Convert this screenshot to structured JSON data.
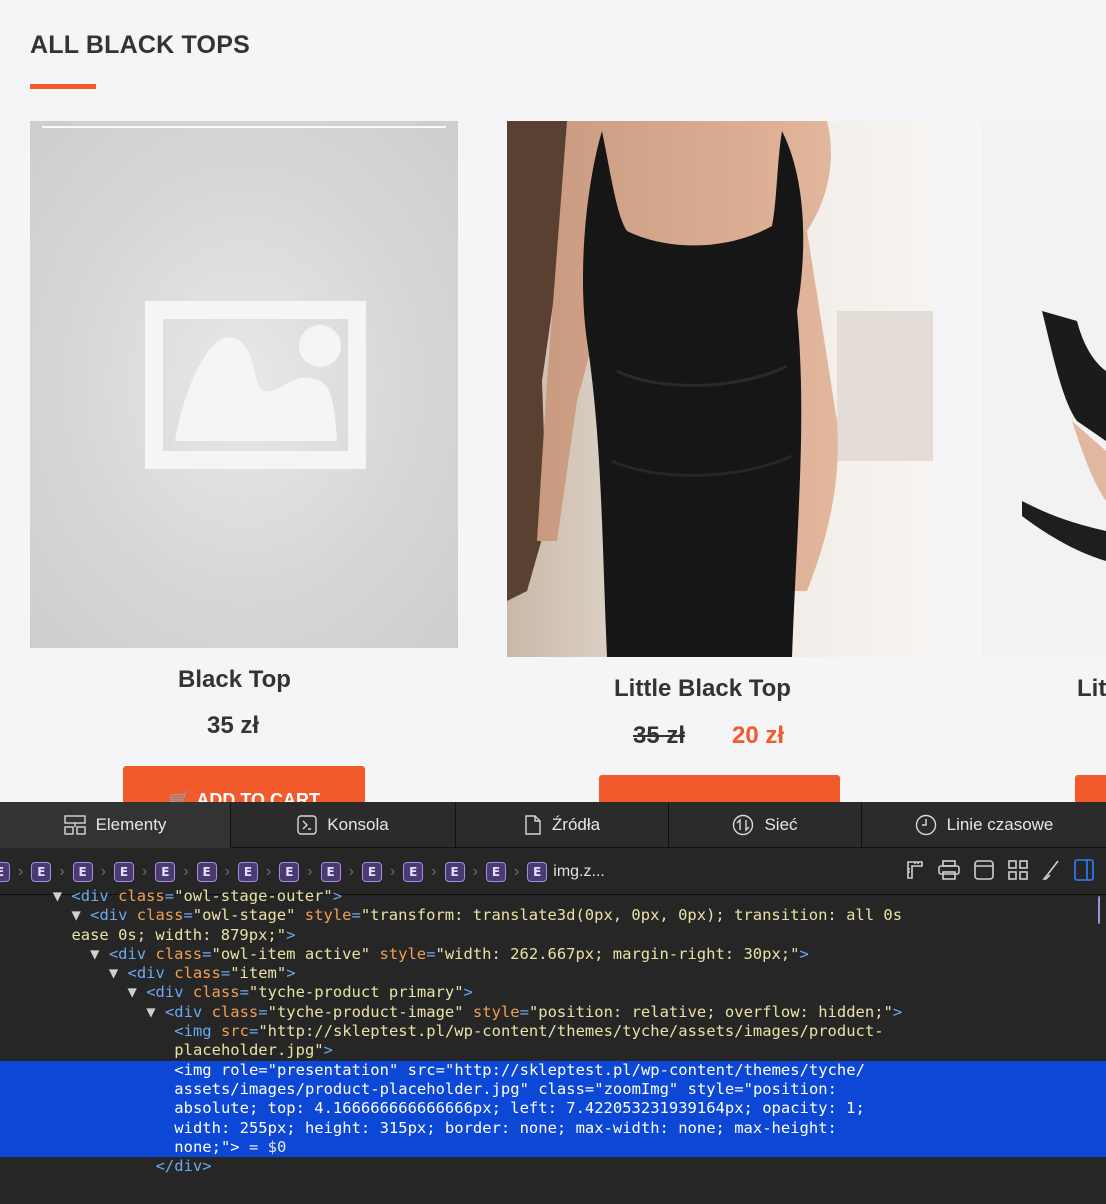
{
  "section": {
    "title": "ALL BLACK TOPS"
  },
  "products": [
    {
      "name": "Black Top",
      "price": "35 zł",
      "button": "ADD TO CART",
      "image": "placeholder-image-icon"
    },
    {
      "name": "Little Black Top",
      "old_price": "35 zł",
      "sale_price": "20 zł",
      "image": "woman-in-black-tank-top-photo"
    },
    {
      "name": "Lit",
      "image": "woman-in-black-long-sleeve-top-photo"
    }
  ],
  "devtools": {
    "tabs": [
      {
        "label": "Elementy",
        "icon": "elements-icon"
      },
      {
        "label": "Konsola",
        "icon": "console-icon"
      },
      {
        "label": "Źródła",
        "icon": "sources-icon"
      },
      {
        "label": "Sieć",
        "icon": "network-icon"
      },
      {
        "label": "Linie czasowe",
        "icon": "timeline-icon"
      }
    ],
    "breadcrumb": {
      "badge": "E",
      "last": "img.z..."
    },
    "dom": [
      {
        "tokens": [
          [
            "tri",
            "▼ "
          ],
          [
            "tag",
            "<div "
          ],
          [
            "attr",
            "class"
          ],
          [
            "tag",
            "="
          ],
          [
            "val",
            "\"owl-stage-outer\""
          ],
          [
            "tag",
            ">"
          ]
        ],
        "indent": 5,
        "clipped": true
      },
      {
        "tokens": [
          [
            "tri",
            "▼ "
          ],
          [
            "tag",
            "<div "
          ],
          [
            "attr",
            "class"
          ],
          [
            "tag",
            "="
          ],
          [
            "val",
            "\"owl-stage\""
          ],
          [
            "txt",
            " "
          ],
          [
            "attr",
            "style"
          ],
          [
            "tag",
            "="
          ],
          [
            "val",
            "\"transform: translate3d(0px, 0px, 0px); transition: all 0s"
          ]
        ],
        "indent": 7
      },
      {
        "tokens": [
          [
            "val",
            "ease 0s; width: 879px;\""
          ],
          [
            "tag",
            ">"
          ]
        ],
        "indent": 7
      },
      {
        "tokens": [
          [
            "tri",
            "▼ "
          ],
          [
            "tag",
            "<div "
          ],
          [
            "attr",
            "class"
          ],
          [
            "tag",
            "="
          ],
          [
            "val",
            "\"owl-item active\""
          ],
          [
            "txt",
            " "
          ],
          [
            "attr",
            "style"
          ],
          [
            "tag",
            "="
          ],
          [
            "val",
            "\"width: 262.667px; margin-right: 30px;\""
          ],
          [
            "tag",
            ">"
          ]
        ],
        "indent": 9
      },
      {
        "tokens": [
          [
            "tri",
            "▼ "
          ],
          [
            "tag",
            "<div "
          ],
          [
            "attr",
            "class"
          ],
          [
            "tag",
            "="
          ],
          [
            "val",
            "\"item\""
          ],
          [
            "tag",
            ">"
          ]
        ],
        "indent": 11
      },
      {
        "tokens": [
          [
            "tri",
            "▼ "
          ],
          [
            "tag",
            "<div "
          ],
          [
            "attr",
            "class"
          ],
          [
            "tag",
            "="
          ],
          [
            "val",
            "\"tyche-product primary\""
          ],
          [
            "tag",
            ">"
          ]
        ],
        "indent": 13
      },
      {
        "tokens": [
          [
            "tri",
            "▼ "
          ],
          [
            "tag",
            "<div "
          ],
          [
            "attr",
            "class"
          ],
          [
            "tag",
            "="
          ],
          [
            "val",
            "\"tyche-product-image\""
          ],
          [
            "txt",
            " "
          ],
          [
            "attr",
            "style"
          ],
          [
            "tag",
            "="
          ],
          [
            "val",
            "\"position: relative; overflow: hidden;\""
          ],
          [
            "tag",
            ">"
          ]
        ],
        "indent": 15
      },
      {
        "tokens": [
          [
            "tag",
            "<img "
          ],
          [
            "attr",
            "src"
          ],
          [
            "tag",
            "="
          ],
          [
            "val",
            "\"http://skleptest.pl/wp-content/themes/tyche/assets/images/product-"
          ]
        ],
        "indent": 18
      },
      {
        "tokens": [
          [
            "val",
            "placeholder.jpg\""
          ],
          [
            "tag",
            ">"
          ]
        ],
        "indent": 18
      },
      {
        "tokens": [
          [
            "tag",
            "<img "
          ],
          [
            "attr",
            "role"
          ],
          [
            "tag",
            "="
          ],
          [
            "val",
            "\"presentation\""
          ],
          [
            "txt",
            " "
          ],
          [
            "attr",
            "src"
          ],
          [
            "tag",
            "="
          ],
          [
            "val",
            "\"http://skleptest.pl/wp-content/themes/tyche/"
          ]
        ],
        "indent": 18,
        "selected": true
      },
      {
        "tokens": [
          [
            "val",
            "assets/images/product-placeholder.jpg\""
          ],
          [
            "txt",
            " "
          ],
          [
            "attr",
            "class"
          ],
          [
            "tag",
            "="
          ],
          [
            "val",
            "\"zoomImg\""
          ],
          [
            "txt",
            " "
          ],
          [
            "attr",
            "style"
          ],
          [
            "tag",
            "="
          ],
          [
            "val",
            "\"position:"
          ]
        ],
        "indent": 18,
        "selected": true
      },
      {
        "tokens": [
          [
            "val",
            "absolute; top: 4.166666666666666px; left: 7.422053231939164px; opacity: 1;"
          ]
        ],
        "indent": 18,
        "selected": true
      },
      {
        "tokens": [
          [
            "val",
            "width: 255px; height: 315px; border: none; max-width: none; max-height:"
          ]
        ],
        "indent": 18,
        "selected": true
      },
      {
        "tokens": [
          [
            "val",
            "none;\""
          ],
          [
            "tag",
            ">"
          ],
          [
            "txt",
            " = $0"
          ]
        ],
        "indent": 18,
        "selected": true
      },
      {
        "tokens": [
          [
            "tag",
            "</div>"
          ]
        ],
        "indent": 16
      }
    ]
  },
  "colors": {
    "accent": "#f15a2b",
    "selection": "#0c47d6"
  }
}
